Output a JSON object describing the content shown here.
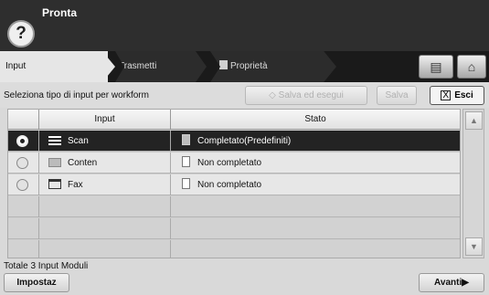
{
  "header": {
    "title": "Pronta",
    "help_symbol": "?"
  },
  "tabs": [
    {
      "label": "Input",
      "active": true
    },
    {
      "label": "Trasmetti",
      "active": false
    },
    {
      "label": "Proprietà",
      "active": false
    }
  ],
  "top_buttons": [
    {
      "icon": "job-status-icon",
      "glyph": "▤"
    },
    {
      "icon": "home-icon",
      "glyph": "⌂"
    }
  ],
  "action_row": {
    "label": "Seleziona tipo di input per workform",
    "save_run": "Salva ed esegui",
    "save_run_icon": "◇",
    "save": "Salva",
    "exit": "Esci",
    "exit_icon": "X"
  },
  "table": {
    "headers": [
      "",
      "Input",
      "Stato"
    ],
    "rows": [
      {
        "input": "Scan",
        "stato": "Completato(Predefiniti)",
        "selected": true
      },
      {
        "input": "Conten",
        "stato": "Non completato",
        "selected": false
      },
      {
        "input": "Fax",
        "stato": "Non completato",
        "selected": false
      }
    ]
  },
  "scrollbar": {
    "up": "▲",
    "down": "▼"
  },
  "footer": {
    "total": "Totale 3 Input Moduli",
    "settings": "Impostaz",
    "next": "Avanti",
    "next_arrow": "▶"
  },
  "colors": {
    "header_bg": "#2e2e2e",
    "selected_row": "#232323",
    "tab_active": "#e6e6e6"
  }
}
